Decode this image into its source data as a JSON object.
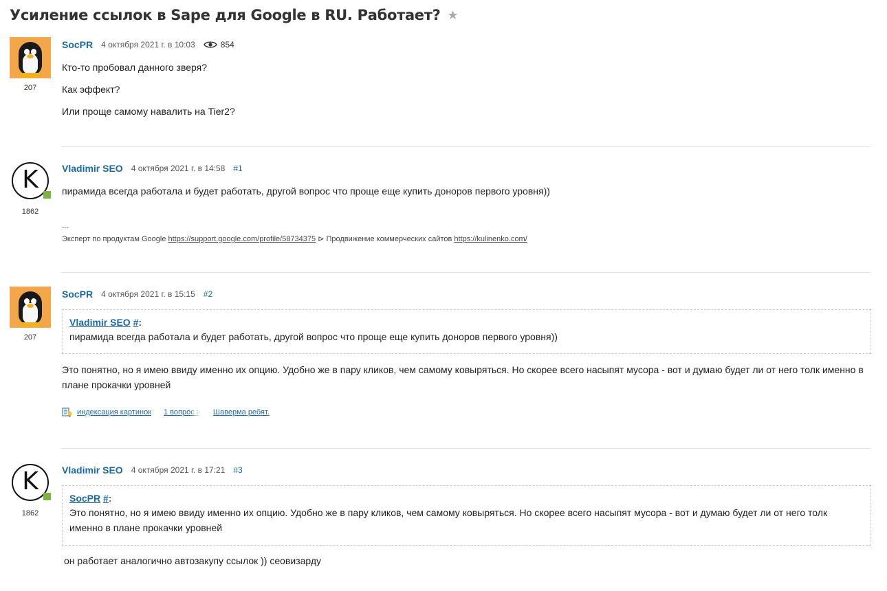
{
  "page": {
    "title": "Усиление ссылок в Sape для Google в RU. Работает?"
  },
  "posts": [
    {
      "author": "SocPR",
      "date": "4 октября 2021 г. в 10:03",
      "views": "854",
      "reputation": "207",
      "avatar": "penguin-avatar",
      "paragraphs": [
        "Кто-то пробовал данного зверя?",
        "Как эффект?",
        "Или проще самому навалить на Tier2?"
      ]
    },
    {
      "author": "Vladimir SEO",
      "date": "4 октября 2021 г. в 14:58",
      "number": "#1",
      "reputation": "1862",
      "avatar": "k-logo-avatar",
      "text": "пирамида всегда работала и будет работать, другой вопрос что проще еще купить доноров первого уровня))",
      "signature": {
        "separator": "---",
        "prefix": "Эксперт по продуктам Google ",
        "link1": "https://support.google.com/profile/58734375",
        "middle": " ⊳ Продвижение коммерческих сайтов ",
        "link2": "https://kulinenko.com/"
      }
    },
    {
      "author": "SocPR",
      "date": "4 октября 2021 г. в 15:15",
      "number": "#2",
      "reputation": "207",
      "avatar": "penguin-avatar",
      "quote": {
        "author": "Vladimir SEO",
        "hash": "#",
        "colon": ":",
        "text": "пирамида всегда работала и будет работать, другой вопрос что проще еще купить доноров первого уровня))"
      },
      "text": "Это понятно, но я имею ввиду именно их опцию. Удобно же в пару кликов, чем самому ковыряться. Но скорее всего насыпят мусора - вот и думаю будет ли от него толк именно в плане прокачки уровней",
      "tags": [
        "индексация картинок",
        "1 вопрос и",
        "Шаверма ребят."
      ]
    },
    {
      "author": "Vladimir SEO",
      "date": "4 октября 2021 г. в 17:21",
      "number": "#3",
      "reputation": "1862",
      "avatar": "k-logo-avatar",
      "quote": {
        "author": "SocPR",
        "hash": "#",
        "colon": ":",
        "text": "Это понятно, но я имею ввиду именно их опцию. Удобно же в пару кликов, чем самому ковыряться. Но скорее всего насыпят мусора - вот и думаю будет ли от него толк именно в плане прокачки уровней"
      },
      "text": "он работает аналогично автозакупу ссылок )) сеовизарду"
    }
  ],
  "icons": {
    "star": "star-icon",
    "views": "eye-icon",
    "tags": "idea-list-icon"
  },
  "colors": {
    "link": "#1a6aa8",
    "online": "#7cb342",
    "avatar_bg": "#f4a64a"
  }
}
